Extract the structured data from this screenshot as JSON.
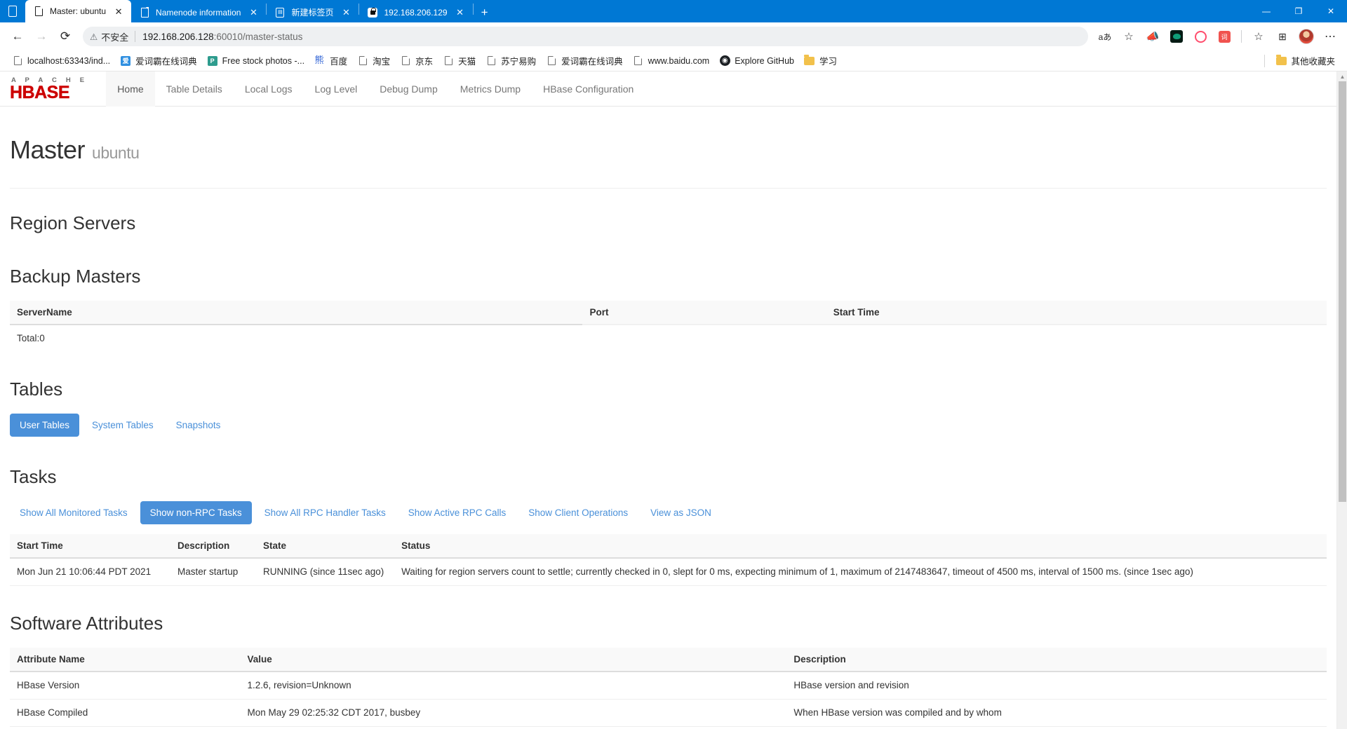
{
  "browser": {
    "tabs": [
      {
        "title": "Master: ubuntu",
        "icon": "page-icon",
        "active": true,
        "closable": true
      },
      {
        "title": "Namenode information",
        "icon": "page-icon",
        "active": false,
        "closable": true
      },
      {
        "title": "新建标签页",
        "icon": "newtab-icon",
        "active": false,
        "closable": true
      },
      {
        "title": "192.168.206.129",
        "icon": "lock-icon",
        "active": false,
        "closable": true
      }
    ],
    "new_tab_label": "+",
    "window_controls": {
      "minimize": "—",
      "maximize": "❐",
      "close": "✕"
    },
    "nav": {
      "back": "←",
      "forward": "→",
      "reload": "⟳"
    },
    "omnibox": {
      "warning_icon": "warning-triangle-icon",
      "security_label": "不安全",
      "url_host": "192.168.206.128",
      "url_path": ":60010/master-status",
      "full_url": "192.168.206.128:60010/master-status"
    },
    "toolbar_icons": [
      {
        "name": "read-aloud-icon",
        "glyph": "aあ"
      },
      {
        "name": "add-favorite-icon",
        "glyph": "☆"
      },
      {
        "name": "extension-megaphone-icon",
        "glyph": "📣"
      },
      {
        "name": "extension-green-icon",
        "glyph": ""
      },
      {
        "name": "extension-ring-icon",
        "glyph": ""
      },
      {
        "name": "extension-translate-icon",
        "glyph": "词"
      },
      {
        "name": "favorites-list-icon",
        "glyph": "☆"
      },
      {
        "name": "collections-icon",
        "glyph": "⊞"
      },
      {
        "name": "profile-avatar",
        "glyph": ""
      },
      {
        "name": "settings-more-icon",
        "glyph": "⋯"
      }
    ],
    "bookmarks": [
      {
        "label": "localhost:63343/ind...",
        "icon": "page-icon"
      },
      {
        "label": "爱词霸在线词典",
        "icon": "iciba-icon",
        "color": "#2f8fe0"
      },
      {
        "label": "Free stock photos -...",
        "icon": "pexels-icon",
        "color": "#2e9c8e"
      },
      {
        "label": "百度",
        "icon": "baidu-icon"
      },
      {
        "label": "淘宝",
        "icon": "page-icon"
      },
      {
        "label": "京东",
        "icon": "page-icon"
      },
      {
        "label": "天猫",
        "icon": "page-icon"
      },
      {
        "label": "苏宁易购",
        "icon": "page-icon"
      },
      {
        "label": "爱词霸在线词典",
        "icon": "page-icon"
      },
      {
        "label": "www.baidu.com",
        "icon": "page-icon"
      },
      {
        "label": "Explore GitHub",
        "icon": "github-icon"
      },
      {
        "label": "学习",
        "icon": "folder-icon"
      }
    ],
    "bookmarks_overflow": {
      "label": "其他收藏夹",
      "icon": "folder-icon"
    }
  },
  "hbase": {
    "brand": {
      "apache": "A P A C H E",
      "product": "HBASE"
    },
    "nav_links": [
      {
        "label": "Home",
        "active": true
      },
      {
        "label": "Table Details",
        "active": false
      },
      {
        "label": "Local Logs",
        "active": false
      },
      {
        "label": "Log Level",
        "active": false
      },
      {
        "label": "Debug Dump",
        "active": false
      },
      {
        "label": "Metrics Dump",
        "active": false
      },
      {
        "label": "HBase Configuration",
        "active": false
      }
    ],
    "page_title": "Master",
    "page_subtitle": "ubuntu",
    "region_servers": {
      "heading": "Region Servers"
    },
    "backup_masters": {
      "heading": "Backup Masters",
      "columns": [
        "ServerName",
        "Port",
        "Start Time"
      ],
      "rows": [],
      "total_label": "Total:0"
    },
    "tables": {
      "heading": "Tables",
      "tabs": [
        {
          "label": "User Tables",
          "active": true
        },
        {
          "label": "System Tables",
          "active": false
        },
        {
          "label": "Snapshots",
          "active": false
        }
      ]
    },
    "tasks": {
      "heading": "Tasks",
      "tabs": [
        {
          "label": "Show All Monitored Tasks",
          "active": false
        },
        {
          "label": "Show non-RPC Tasks",
          "active": true
        },
        {
          "label": "Show All RPC Handler Tasks",
          "active": false
        },
        {
          "label": "Show Active RPC Calls",
          "active": false
        },
        {
          "label": "Show Client Operations",
          "active": false
        },
        {
          "label": "View as JSON",
          "active": false
        }
      ],
      "columns": [
        "Start Time",
        "Description",
        "State",
        "Status"
      ],
      "rows": [
        {
          "start_time": "Mon Jun 21 10:06:44 PDT 2021",
          "description": "Master startup",
          "state": "RUNNING (since 11sec ago)",
          "status": "Waiting for region servers count to settle; currently checked in 0, slept for 0 ms, expecting minimum of 1, maximum of 2147483647, timeout of 4500 ms, interval of 1500 ms. (since 1sec ago)"
        }
      ]
    },
    "software_attributes": {
      "heading": "Software Attributes",
      "columns": [
        "Attribute Name",
        "Value",
        "Description"
      ],
      "rows": [
        {
          "name": "HBase Version",
          "value": "1.2.6, revision=Unknown",
          "description": "HBase version and revision"
        },
        {
          "name": "HBase Compiled",
          "value": "Mon May 29 02:25:32 CDT 2017, busbey",
          "description": "When HBase version was compiled and by whom"
        }
      ]
    }
  },
  "colors": {
    "browser_accent": "#0078d4",
    "hbase_red": "#cc0000",
    "pill_active": "#4a90d9",
    "link_blue": "#4a90d9"
  }
}
